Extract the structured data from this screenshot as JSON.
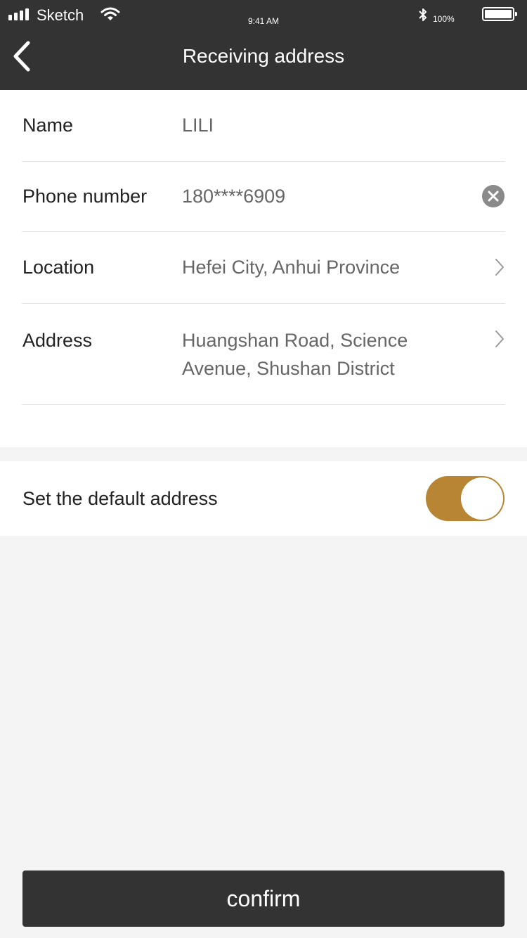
{
  "status_bar": {
    "carrier": "Sketch",
    "time": "9:41 AM",
    "battery_percent": "100%",
    "battery_level": 1.0
  },
  "header": {
    "title": "Receiving address"
  },
  "form": {
    "name": {
      "label": "Name",
      "value": "LILI"
    },
    "phone": {
      "label": "Phone number",
      "value": "180****6909"
    },
    "location": {
      "label": "Location",
      "value": "Hefei City, Anhui Province"
    },
    "address": {
      "label": "Address",
      "value": "Huangshan Road, Science Avenue, Shushan District"
    }
  },
  "default_address": {
    "label": "Set the default address",
    "enabled": true
  },
  "confirm_label": "confirm",
  "colors": {
    "header_bg": "#333333",
    "accent": "#b78533",
    "page_bg": "#f4f4f4",
    "button_bg": "#333333"
  }
}
